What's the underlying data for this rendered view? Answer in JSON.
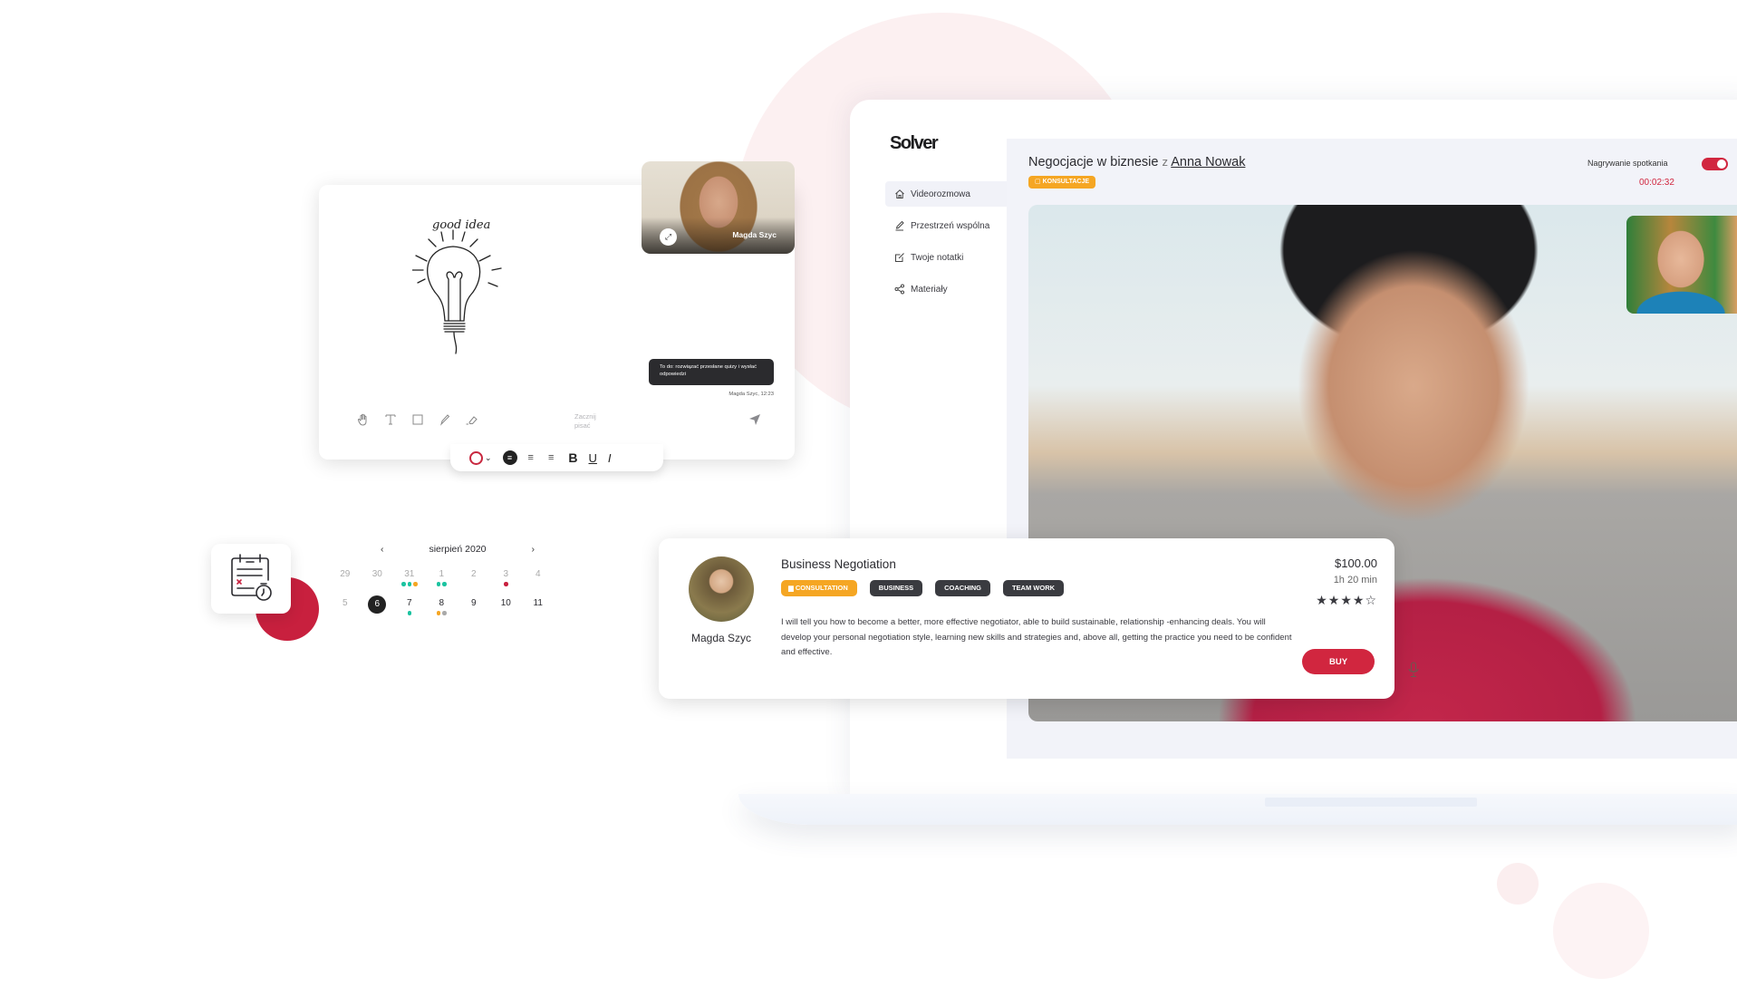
{
  "app": {
    "logo": "Solver"
  },
  "sidebar": {
    "items": [
      {
        "label": "Videorozmowa",
        "icon": "home-icon",
        "active": true
      },
      {
        "label": "Przestrzeń wspólna",
        "icon": "pen-icon",
        "active": false
      },
      {
        "label": "Twoje notatki",
        "icon": "edit-note-icon",
        "active": false
      },
      {
        "label": "Materiały",
        "icon": "share-icon",
        "active": false
      }
    ]
  },
  "call": {
    "title": "Negocjacje w biznesie",
    "with_word": "z",
    "person": "Anna Nowak",
    "badge": "KONSULTACJE",
    "recording_label": "Nagrywanie spotkania",
    "recording_on": true,
    "timer": "00:02:32"
  },
  "course": {
    "author": "Magda Szyc",
    "title": "Business Negotiation",
    "tags": [
      "CONSULTATION",
      "BUSINESS",
      "COACHING",
      "TEAM WORK"
    ],
    "description": "I will tell you how to become a better, more effective negotiator, able to build sustainable, relationship -enhancing deals. You will develop your personal negotiation style, learning new skills and strategies and, above all, getting the practice you need to be confident and effective.",
    "price": "$100.00",
    "duration": "1h 20 min",
    "rating": 4,
    "rating_max": 5,
    "stars_text": "★★★★☆",
    "buy_label": "BUY"
  },
  "whiteboard": {
    "drawing_caption": "good idea",
    "video_name": "Magda Szyc",
    "chat_message": "To do: rozwiązać przesłane quizy i wysłać odpowiedzi",
    "chat_meta": "Magda Szyc, 12:23",
    "input_placeholder": "Zacznij pisać",
    "tools": [
      "hand-tool",
      "text-tool",
      "rectangle-tool",
      "pencil-tool",
      "eraser-tool"
    ],
    "format": {
      "bold": "B",
      "underline": "U",
      "italic": "I",
      "chevron": "⌄",
      "align_center": "≡",
      "align_left": "≡",
      "align_right": "≡"
    },
    "colors": {
      "pen": "#c8283f"
    }
  },
  "calendar": {
    "month": "sierpień 2020",
    "prev": "‹",
    "next": "›",
    "days": [
      {
        "n": "29",
        "muted": true,
        "dots": []
      },
      {
        "n": "30",
        "muted": true,
        "dots": []
      },
      {
        "n": "31",
        "muted": true,
        "dots": [
          "#1bc3a0",
          "#1bc3a0",
          "#f5a623"
        ]
      },
      {
        "n": "1",
        "muted": true,
        "dots": [
          "#1bc3a0",
          "#1bc3a0"
        ]
      },
      {
        "n": "2",
        "muted": true,
        "dots": []
      },
      {
        "n": "3",
        "muted": true,
        "dots": [
          "#c8203e"
        ]
      },
      {
        "n": "4",
        "muted": true,
        "dots": []
      },
      {
        "n": "5",
        "muted": true,
        "dots": []
      },
      {
        "n": "6",
        "selected": true,
        "dots": []
      },
      {
        "n": "7",
        "dots": [
          "#1bc3a0"
        ]
      },
      {
        "n": "8",
        "dots": [
          "#f5a623",
          "#aaaaaa"
        ]
      },
      {
        "n": "9",
        "dots": []
      },
      {
        "n": "10",
        "dots": []
      },
      {
        "n": "11",
        "dots": []
      }
    ]
  },
  "colors": {
    "accent": "#d1263f",
    "badge_orange": "#f5a623",
    "tag_dark": "#3a3b40",
    "event_green": "#1bc3a0"
  }
}
